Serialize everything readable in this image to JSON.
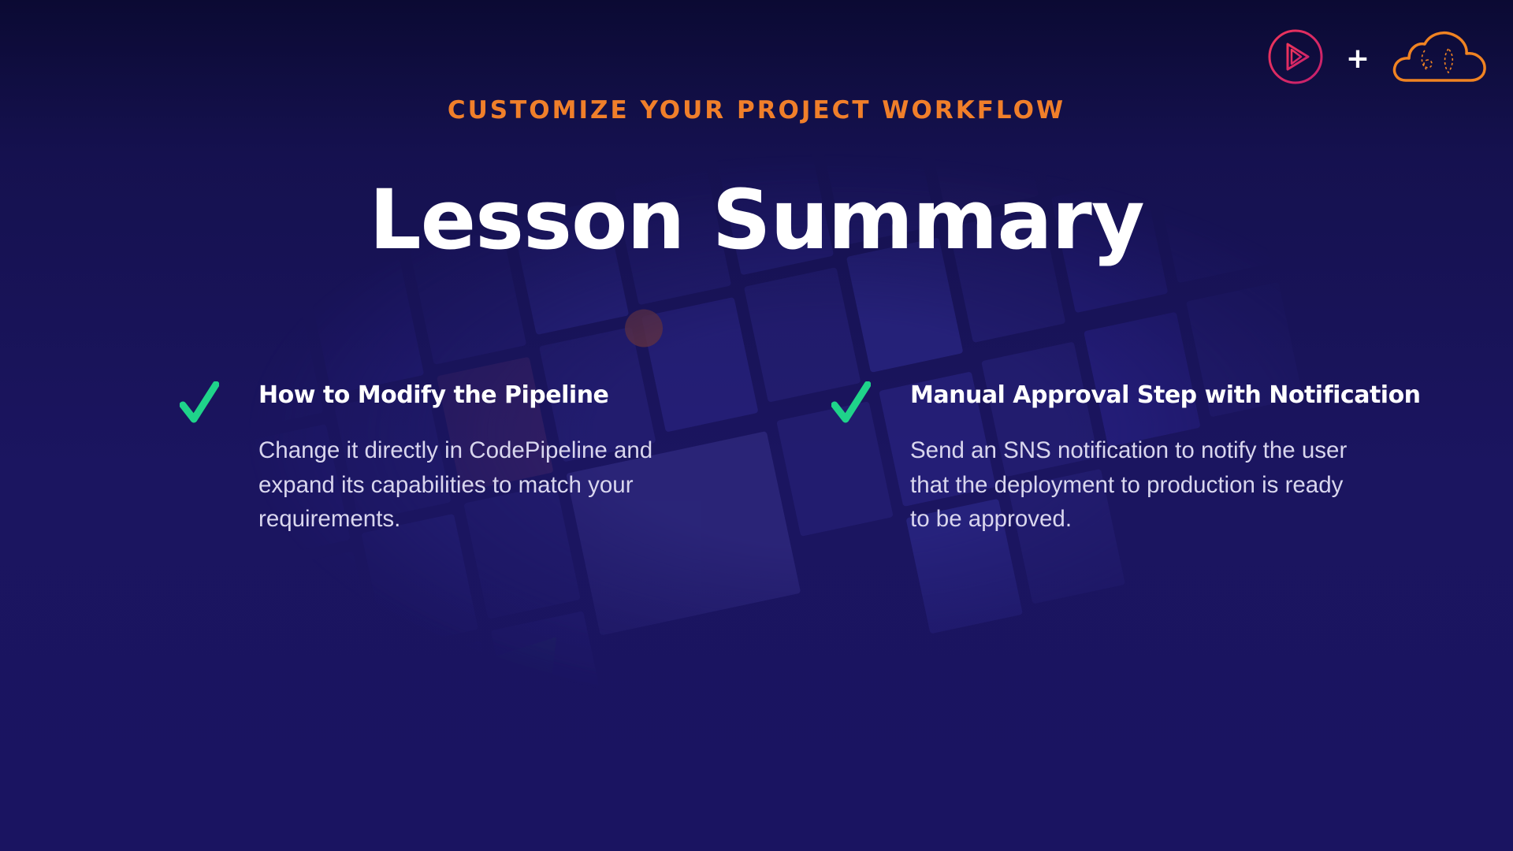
{
  "header": {
    "eyebrow": "CUSTOMIZE YOUR PROJECT WORKFLOW",
    "title": "Lesson Summary"
  },
  "logos": {
    "primary_icon": "play-circle-logo",
    "separator": "+",
    "secondary_icon": "cloud-logo",
    "primary_color": "#e32a52",
    "secondary_color": "#f08322"
  },
  "items": [
    {
      "icon": "checkmark-icon",
      "heading": "How to Modify the Pipeline",
      "body": "Change it directly in CodePipeline and expand its capabilities to match your requirements."
    },
    {
      "icon": "checkmark-icon",
      "heading": "Manual Approval Step with Notification",
      "body": "Send an SNS notification to notify the user that the deployment to production is ready to be approved."
    }
  ],
  "colors": {
    "background": "#1a1461",
    "accent": "#f07f2a",
    "check": "#1fd38a",
    "title": "#ffffff",
    "body_text": "#d9d6ee"
  }
}
